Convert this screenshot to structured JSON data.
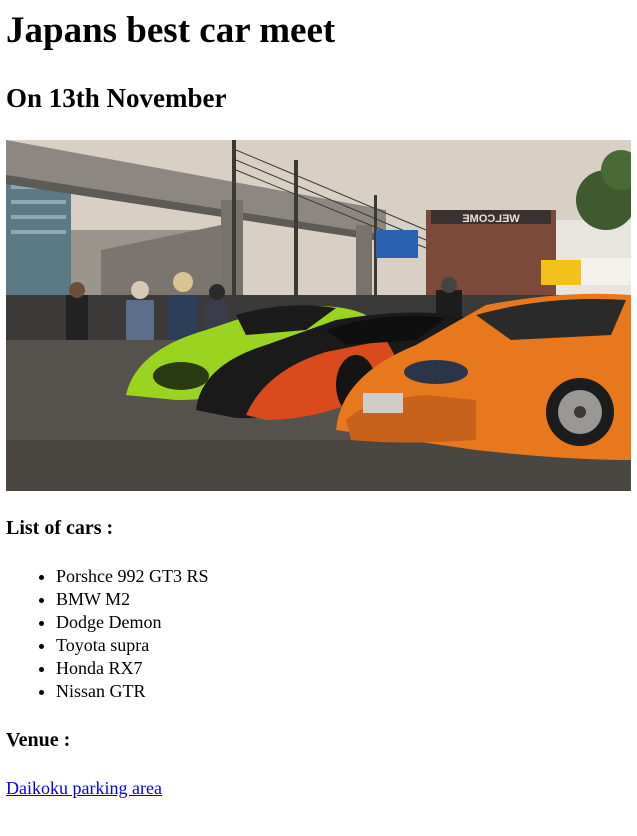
{
  "page": {
    "title": "Japans best car meet",
    "subtitle": "On 13th November"
  },
  "photo": {
    "sign_text": "WELCOME",
    "palette": {
      "sky": "#d9d2c8",
      "asphalt": "#56524e",
      "orange_car": "#e8781e",
      "green_car": "#9bd321",
      "red_car": "#d94a1c",
      "black_car": "#1a1a1a"
    }
  },
  "cars_section": {
    "heading": "List of cars :",
    "items": [
      "Porshce 992 GT3 RS",
      "BMW M2",
      "Dodge Demon",
      "Toyota supra",
      "Honda RX7",
      "Nissan GTR"
    ]
  },
  "venue_section": {
    "heading": "Venue :",
    "link_text": "Daikoku parking area"
  }
}
